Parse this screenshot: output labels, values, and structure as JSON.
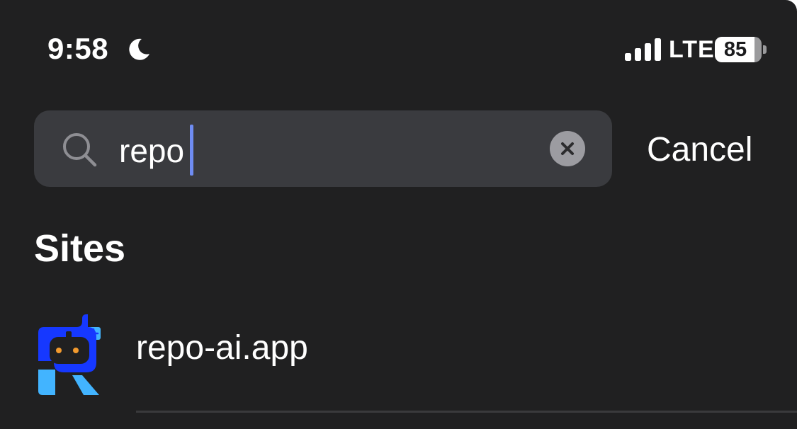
{
  "status_bar": {
    "time": "9:58",
    "focus_icon": "moon-icon",
    "signal_icon": "cellular-signal-icon",
    "signal_bars": 4,
    "network": "LTE",
    "battery_level": "85",
    "battery_fraction": 0.85
  },
  "search": {
    "icon": "magnifying-glass-icon",
    "value": "repo",
    "clear_icon": "clear-x-icon",
    "cancel_label": "Cancel"
  },
  "sites": {
    "title": "Sites",
    "items": [
      {
        "icon": "repo-ai-logo",
        "label": "repo-ai.app"
      }
    ]
  },
  "colors": {
    "background": "#202021",
    "search_field": "#3a3b3f",
    "caret": "#6f8cf2",
    "logo_blue": "#1638ff",
    "logo_light_blue": "#42b4ff",
    "logo_eyes": "#f29a2e"
  }
}
